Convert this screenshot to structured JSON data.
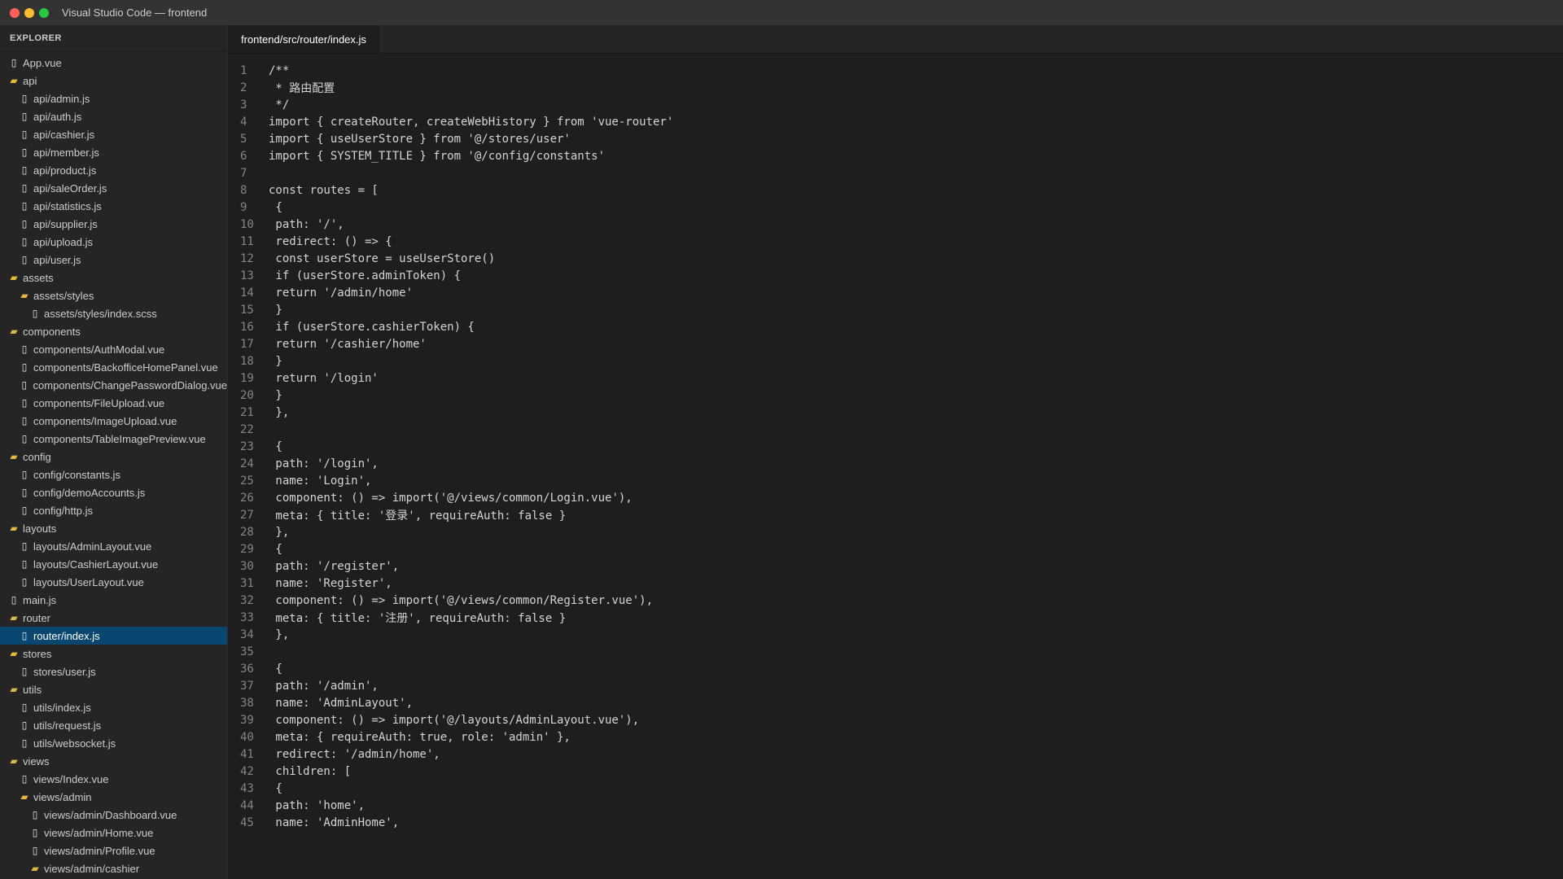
{
  "window": {
    "title": "Visual Studio Code — frontend",
    "traffic_colors": [
      "#ff5f57",
      "#febc2e",
      "#28c840"
    ]
  },
  "sidebar": {
    "header": "EXPLORER",
    "items": [
      {
        "label": "App.vue",
        "type": "file",
        "depth": 0
      },
      {
        "label": "api",
        "type": "folder",
        "depth": 0
      },
      {
        "label": "api/admin.js",
        "type": "file",
        "depth": 1
      },
      {
        "label": "api/auth.js",
        "type": "file",
        "depth": 1
      },
      {
        "label": "api/cashier.js",
        "type": "file",
        "depth": 1
      },
      {
        "label": "api/member.js",
        "type": "file",
        "depth": 1
      },
      {
        "label": "api/product.js",
        "type": "file",
        "depth": 1
      },
      {
        "label": "api/saleOrder.js",
        "type": "file",
        "depth": 1
      },
      {
        "label": "api/statistics.js",
        "type": "file",
        "depth": 1
      },
      {
        "label": "api/supplier.js",
        "type": "file",
        "depth": 1
      },
      {
        "label": "api/upload.js",
        "type": "file",
        "depth": 1
      },
      {
        "label": "api/user.js",
        "type": "file",
        "depth": 1
      },
      {
        "label": "assets",
        "type": "folder",
        "depth": 0
      },
      {
        "label": "assets/styles",
        "type": "folder",
        "depth": 1
      },
      {
        "label": "assets/styles/index.scss",
        "type": "file",
        "depth": 2
      },
      {
        "label": "components",
        "type": "folder",
        "depth": 0
      },
      {
        "label": "components/AuthModal.vue",
        "type": "file",
        "depth": 1
      },
      {
        "label": "components/BackofficeHomePanel.vue",
        "type": "file",
        "depth": 1
      },
      {
        "label": "components/ChangePasswordDialog.vue",
        "type": "file",
        "depth": 1
      },
      {
        "label": "components/FileUpload.vue",
        "type": "file",
        "depth": 1
      },
      {
        "label": "components/ImageUpload.vue",
        "type": "file",
        "depth": 1
      },
      {
        "label": "components/TableImagePreview.vue",
        "type": "file",
        "depth": 1
      },
      {
        "label": "config",
        "type": "folder",
        "depth": 0
      },
      {
        "label": "config/constants.js",
        "type": "file",
        "depth": 1
      },
      {
        "label": "config/demoAccounts.js",
        "type": "file",
        "depth": 1
      },
      {
        "label": "config/http.js",
        "type": "file",
        "depth": 1
      },
      {
        "label": "layouts",
        "type": "folder",
        "depth": 0
      },
      {
        "label": "layouts/AdminLayout.vue",
        "type": "file",
        "depth": 1
      },
      {
        "label": "layouts/CashierLayout.vue",
        "type": "file",
        "depth": 1
      },
      {
        "label": "layouts/UserLayout.vue",
        "type": "file",
        "depth": 1
      },
      {
        "label": "main.js",
        "type": "file",
        "depth": 0
      },
      {
        "label": "router",
        "type": "folder",
        "depth": 0
      },
      {
        "label": "router/index.js",
        "type": "file",
        "depth": 1,
        "selected": true
      },
      {
        "label": "stores",
        "type": "folder",
        "depth": 0
      },
      {
        "label": "stores/user.js",
        "type": "file",
        "depth": 1
      },
      {
        "label": "utils",
        "type": "folder",
        "depth": 0
      },
      {
        "label": "utils/index.js",
        "type": "file",
        "depth": 1
      },
      {
        "label": "utils/request.js",
        "type": "file",
        "depth": 1
      },
      {
        "label": "utils/websocket.js",
        "type": "file",
        "depth": 1
      },
      {
        "label": "views",
        "type": "folder",
        "depth": 0
      },
      {
        "label": "views/Index.vue",
        "type": "file",
        "depth": 1
      },
      {
        "label": "views/admin",
        "type": "folder",
        "depth": 1
      },
      {
        "label": "views/admin/Dashboard.vue",
        "type": "file",
        "depth": 2
      },
      {
        "label": "views/admin/Home.vue",
        "type": "file",
        "depth": 2
      },
      {
        "label": "views/admin/Profile.vue",
        "type": "file",
        "depth": 2
      },
      {
        "label": "views/admin/cashier",
        "type": "folder",
        "depth": 2
      }
    ]
  },
  "editor": {
    "tab_label": "frontend/src/router/index.js",
    "lines": [
      "/**",
      " * 路由配置",
      " */",
      "import { createRouter, createWebHistory } from 'vue-router'",
      "import { useUserStore } from '@/stores/user'",
      "import { SYSTEM_TITLE } from '@/config/constants'",
      "",
      "const routes = [",
      " {",
      " path: '/',",
      " redirect: () => {",
      " const userStore = useUserStore()",
      " if (userStore.adminToken) {",
      " return '/admin/home'",
      " }",
      " if (userStore.cashierToken) {",
      " return '/cashier/home'",
      " }",
      " return '/login'",
      " }",
      " },",
      "",
      " {",
      " path: '/login',",
      " name: 'Login',",
      " component: () => import('@/views/common/Login.vue'),",
      " meta: { title: '登录', requireAuth: false }",
      " },",
      " {",
      " path: '/register',",
      " name: 'Register',",
      " component: () => import('@/views/common/Register.vue'),",
      " meta: { title: '注册', requireAuth: false }",
      " },",
      "",
      " {",
      " path: '/admin',",
      " name: 'AdminLayout',",
      " component: () => import('@/layouts/AdminLayout.vue'),",
      " meta: { requireAuth: true, role: 'admin' },",
      " redirect: '/admin/home',",
      " children: [",
      " {",
      " path: 'home',",
      " name: 'AdminHome',"
    ]
  }
}
